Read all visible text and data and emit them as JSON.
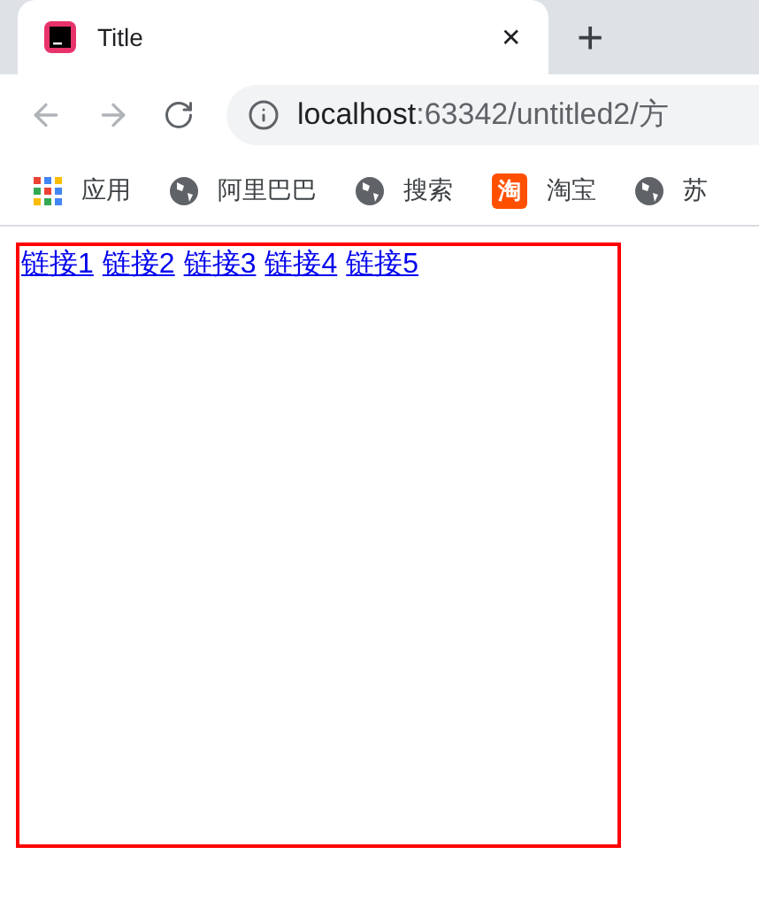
{
  "tab": {
    "title": "Title",
    "close": "✕",
    "new_tab": "+"
  },
  "address": {
    "host": "localhost",
    "path": ":63342/untitled2/方"
  },
  "bookmarks": [
    {
      "kind": "apps",
      "label": "应用"
    },
    {
      "kind": "globe",
      "label": "阿里巴巴"
    },
    {
      "kind": "globe",
      "label": "搜索"
    },
    {
      "kind": "taobao",
      "label": "淘宝",
      "icon_text": "淘"
    },
    {
      "kind": "globe",
      "label": "苏"
    }
  ],
  "links": [
    "链接1",
    "链接2",
    "链接3",
    "链接4",
    "链接5"
  ]
}
